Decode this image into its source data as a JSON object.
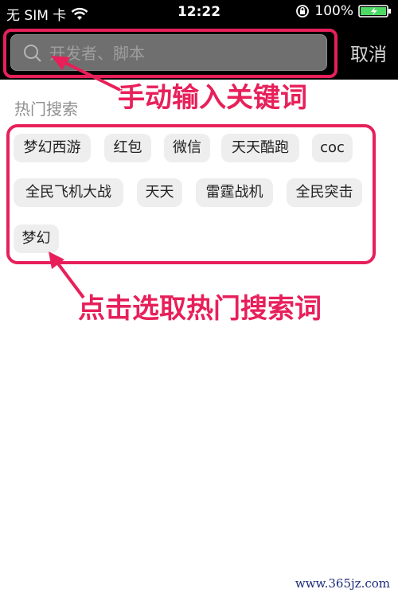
{
  "status_bar": {
    "carrier": "无 SIM 卡",
    "time": "12:22",
    "battery": "100%",
    "icons": [
      "wifi-icon",
      "orientation-lock-icon",
      "battery-icon"
    ]
  },
  "search": {
    "placeholder": "开发者、脚本",
    "value": "",
    "cancel_label": "取消"
  },
  "hot_search": {
    "title": "热门搜索",
    "tags": [
      "梦幻西游",
      "红包",
      "微信",
      "天天酷跑",
      "coc",
      "全民飞机大战",
      "天天",
      "雷霆战机",
      "全民突击",
      "梦幻"
    ]
  },
  "annotations": {
    "manual_input": "手动输入关键词",
    "tap_select": "点击选取热门搜索词"
  },
  "watermark": "www.365jz.com",
  "colors": {
    "highlight": "#e7205a",
    "header_bg": "#000000",
    "tag_bg": "#eeeeee"
  }
}
